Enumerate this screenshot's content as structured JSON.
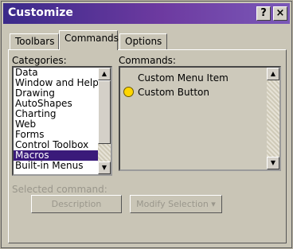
{
  "window": {
    "title": "Customize"
  },
  "titlebar": {
    "help": "?",
    "close": "×"
  },
  "tabs": [
    {
      "label": "Toolbars"
    },
    {
      "label": "Commands"
    },
    {
      "label": "Options"
    }
  ],
  "categories": {
    "label": "Categories:",
    "items": [
      "Data",
      "Window and Help",
      "Drawing",
      "AutoShapes",
      "Charting",
      "Web",
      "Forms",
      "Control Toolbox",
      "Macros",
      "Built-in Menus"
    ],
    "selected_index": 8
  },
  "commands": {
    "label": "Commands:",
    "items": [
      {
        "label": "Custom Menu Item",
        "icon": ""
      },
      {
        "label": "Custom Button",
        "icon": "smiley-icon"
      }
    ]
  },
  "selected_command": {
    "label": "Selected command:",
    "description_button": "Description",
    "modify_button": "Modify Selection ▾"
  },
  "colors": {
    "selection": "#3a1a7a",
    "titlebar_start": "#3a2a8a",
    "titlebar_end": "#7a58b8"
  }
}
